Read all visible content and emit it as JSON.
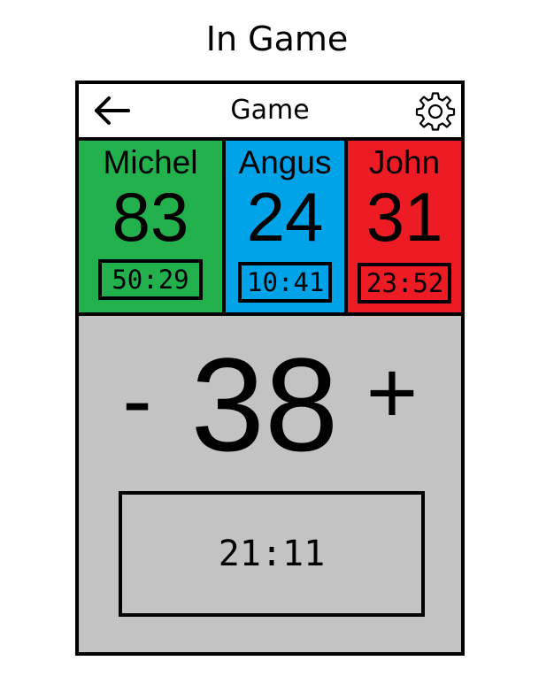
{
  "page": {
    "heading": "In Game"
  },
  "header": {
    "title": "Game",
    "back_icon": "arrow-left-icon",
    "settings_icon": "gear-icon"
  },
  "players": [
    {
      "name": "Michel",
      "score": "83",
      "time": "50:29",
      "color": "#22b14c"
    },
    {
      "name": "Angus",
      "score": "24",
      "time": "10:41",
      "color": "#00a2e8"
    },
    {
      "name": "John",
      "score": "31",
      "time": "23:52",
      "color": "#ed1c24"
    }
  ],
  "main": {
    "minus_label": "-",
    "value": "38",
    "plus_label": "+",
    "timer": "21:11",
    "background": "#c3c3c3"
  }
}
